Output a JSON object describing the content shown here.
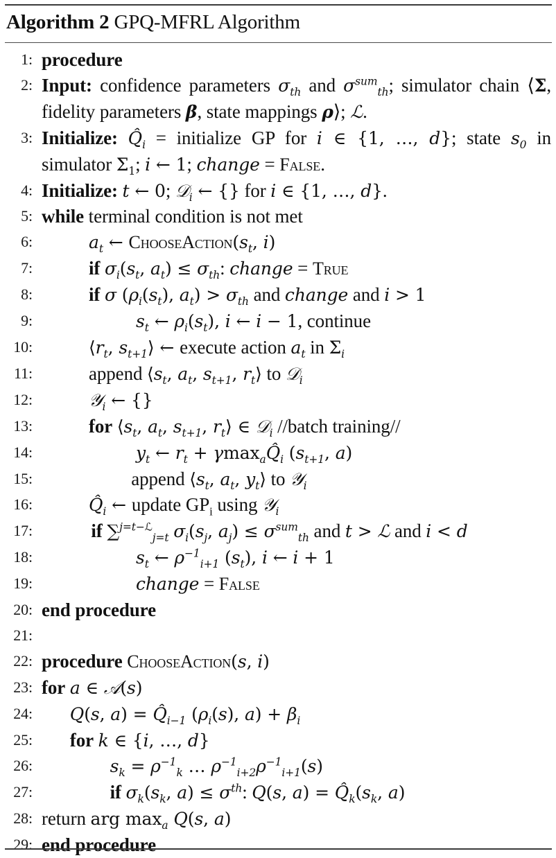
{
  "caption": {
    "label": "Algorithm 2",
    "title": "GPQ-MFRL Algorithm"
  },
  "lines": [
    {
      "n": "1:",
      "indent": 0,
      "segs": [
        [
          "kw",
          "procedure"
        ]
      ]
    },
    {
      "n": "2:",
      "indent": 0,
      "wrap": true,
      "segs": [
        [
          "kw",
          "Input:"
        ],
        [
          "t",
          " confidence parameters "
        ],
        [
          "m",
          "σ<sub>th</sub>"
        ],
        [
          "t",
          " and "
        ],
        [
          "m",
          "σ<sup>sum</sup><sub>th</sub>"
        ],
        [
          "t",
          "; simulator chain ⟨"
        ],
        [
          "mr",
          "<b>Σ</b>"
        ],
        [
          "t",
          ", fidelity parameters "
        ],
        [
          "m",
          "<b>β</b>"
        ],
        [
          "t",
          ", state mappings "
        ],
        [
          "m",
          "<b>ρ</b>"
        ],
        [
          "t",
          "⟩; "
        ],
        [
          "m",
          "ℒ"
        ],
        [
          "t",
          "."
        ]
      ]
    },
    {
      "n": "3:",
      "indent": 0,
      "wrap": true,
      "segs": [
        [
          "kw",
          "Initialize:"
        ],
        [
          "t",
          " "
        ],
        [
          "m",
          "Q̂<sub>i</sub>"
        ],
        [
          "t",
          " = initialize GP for "
        ],
        [
          "m",
          "i"
        ],
        [
          "mr",
          " ∈ {1, …, "
        ],
        [
          "m",
          "d"
        ],
        [
          "mr",
          "}"
        ],
        [
          "t",
          "; state "
        ],
        [
          "m",
          "s<sub>0</sub>"
        ],
        [
          "t",
          " in simulator "
        ],
        [
          "mr",
          "Σ<sub>1</sub>"
        ],
        [
          "t",
          "; "
        ],
        [
          "m",
          "i"
        ],
        [
          "mr",
          " ← 1"
        ],
        [
          "t",
          "; "
        ],
        [
          "m",
          "change"
        ],
        [
          "t",
          " = "
        ],
        [
          "sc",
          "False"
        ],
        [
          "t",
          "."
        ]
      ]
    },
    {
      "n": "4:",
      "indent": 0,
      "segs": [
        [
          "kw",
          "Initialize:"
        ],
        [
          "t",
          " "
        ],
        [
          "m",
          "t"
        ],
        [
          "mr",
          " ← 0"
        ],
        [
          "t",
          "; "
        ],
        [
          "m",
          "𝒟<sub>i</sub>"
        ],
        [
          "mr",
          " ← {}"
        ],
        [
          "t",
          " for "
        ],
        [
          "m",
          "i"
        ],
        [
          "mr",
          " ∈ {1, …, "
        ],
        [
          "m",
          "d"
        ],
        [
          "mr",
          "}"
        ],
        [
          "t",
          "."
        ]
      ]
    },
    {
      "n": "5:",
      "indent": 0,
      "segs": [
        [
          "kw",
          "while"
        ],
        [
          "t",
          " terminal condition is not met"
        ]
      ]
    },
    {
      "n": "6:",
      "indent": 1,
      "segs": [
        [
          "m",
          "a<sub>t</sub>"
        ],
        [
          "mr",
          " ← "
        ],
        [
          "sc",
          "ChooseAction"
        ],
        [
          "mr",
          "("
        ],
        [
          "m",
          "s<sub>t</sub>"
        ],
        [
          "mr",
          ", "
        ],
        [
          "m",
          "i"
        ],
        [
          "mr",
          ")"
        ]
      ]
    },
    {
      "n": "7:",
      "indent": 1,
      "segs": [
        [
          "kw",
          "if"
        ],
        [
          "t",
          " "
        ],
        [
          "m",
          "σ<sub>i</sub>"
        ],
        [
          "mr",
          "("
        ],
        [
          "m",
          "s<sub>t</sub>"
        ],
        [
          "mr",
          ", "
        ],
        [
          "m",
          "a<sub>t</sub>"
        ],
        [
          "mr",
          ") ≤ "
        ],
        [
          "m",
          "σ<sub>th</sub>"
        ],
        [
          "t",
          ": "
        ],
        [
          "m",
          "change"
        ],
        [
          "t",
          " = "
        ],
        [
          "sc",
          "True"
        ]
      ]
    },
    {
      "n": "8:",
      "indent": 1,
      "segs": [
        [
          "kw",
          "if"
        ],
        [
          "t",
          " "
        ],
        [
          "m",
          "σ"
        ],
        [
          "mr",
          " ("
        ],
        [
          "m",
          "ρ<sub>i</sub>"
        ],
        [
          "mr",
          "("
        ],
        [
          "m",
          "s<sub>t</sub>"
        ],
        [
          "mr",
          "), "
        ],
        [
          "m",
          "a<sub>t</sub>"
        ],
        [
          "mr",
          ") > "
        ],
        [
          "m",
          "σ<sub>th</sub>"
        ],
        [
          "t",
          " and "
        ],
        [
          "m",
          "change"
        ],
        [
          "t",
          " and "
        ],
        [
          "m",
          "i"
        ],
        [
          "mr",
          " > 1"
        ]
      ]
    },
    {
      "n": "9:",
      "indent": 2,
      "segs": [
        [
          "m",
          "s<sub>t</sub>"
        ],
        [
          "mr",
          " ← "
        ],
        [
          "m",
          "ρ<sub>i</sub>"
        ],
        [
          "mr",
          "("
        ],
        [
          "m",
          "s<sub>t</sub>"
        ],
        [
          "mr",
          "), "
        ],
        [
          "m",
          "i"
        ],
        [
          "mr",
          " ← "
        ],
        [
          "m",
          "i"
        ],
        [
          "mr",
          " − 1"
        ],
        [
          "t",
          ", continue"
        ]
      ]
    },
    {
      "n": "10:",
      "indent": 1,
      "segs": [
        [
          "mr",
          "⟨"
        ],
        [
          "m",
          "r<sub>t</sub>"
        ],
        [
          "mr",
          ", "
        ],
        [
          "m",
          "s<sub>t+1</sub>"
        ],
        [
          "mr",
          "⟩ ← "
        ],
        [
          "t",
          " execute action "
        ],
        [
          "m",
          "a<sub>t</sub>"
        ],
        [
          "t",
          " in "
        ],
        [
          "mr",
          "Σ<sub><i>i</i></sub>"
        ]
      ]
    },
    {
      "n": "11:",
      "indent": 1,
      "segs": [
        [
          "t",
          "append "
        ],
        [
          "mr",
          "⟨"
        ],
        [
          "m",
          "s<sub>t</sub>"
        ],
        [
          "mr",
          ", "
        ],
        [
          "m",
          "a<sub>t</sub>"
        ],
        [
          "mr",
          ", "
        ],
        [
          "m",
          "s<sub>t+1</sub>"
        ],
        [
          "mr",
          ", "
        ],
        [
          "m",
          "r<sub>t</sub>"
        ],
        [
          "mr",
          "⟩"
        ],
        [
          "t",
          "  to "
        ],
        [
          "m",
          "𝒟<sub>i</sub>"
        ]
      ]
    },
    {
      "n": "12:",
      "indent": 1,
      "segs": [
        [
          "m",
          "𝒴<sub>i</sub>"
        ],
        [
          "mr",
          " ← {}"
        ]
      ]
    },
    {
      "n": "13:",
      "indent": 1,
      "segs": [
        [
          "kw",
          "for"
        ],
        [
          "t",
          " "
        ],
        [
          "mr",
          "⟨"
        ],
        [
          "m",
          "s<sub>t</sub>"
        ],
        [
          "mr",
          ", "
        ],
        [
          "m",
          "a<sub>t</sub>"
        ],
        [
          "mr",
          ", "
        ],
        [
          "m",
          "s<sub>t+1</sub>"
        ],
        [
          "mr",
          ", "
        ],
        [
          "m",
          "r<sub>t</sub>"
        ],
        [
          "mr",
          "⟩ ∈ "
        ],
        [
          "m",
          "𝒟<sub>i</sub>"
        ],
        [
          "t",
          " //batch training//"
        ]
      ]
    },
    {
      "n": "14:",
      "indent": 2,
      "segs": [
        [
          "m",
          "y<sub>t</sub>"
        ],
        [
          "mr",
          " ← "
        ],
        [
          "m",
          "r<sub>t</sub>"
        ],
        [
          "mr",
          " + "
        ],
        [
          "m",
          "γ"
        ],
        [
          "mr",
          "max<sub><i>a</i></sub>"
        ],
        [
          "m",
          "Q̂<sub>i</sub>"
        ],
        [
          "mr",
          " ("
        ],
        [
          "m",
          "s<sub>t+1</sub>"
        ],
        [
          "mr",
          ", "
        ],
        [
          "m",
          "a"
        ],
        [
          "mr",
          ")"
        ]
      ]
    },
    {
      "n": "15:",
      "indent": 1.9,
      "segs": [
        [
          "t",
          "append "
        ],
        [
          "mr",
          "⟨"
        ],
        [
          "m",
          "s<sub>t</sub>"
        ],
        [
          "mr",
          ", "
        ],
        [
          "m",
          "a<sub>t</sub>"
        ],
        [
          "mr",
          ", "
        ],
        [
          "m",
          "y<sub>t</sub>"
        ],
        [
          "mr",
          "⟩"
        ],
        [
          "t",
          " to "
        ],
        [
          "m",
          "𝒴<sub>i</sub>"
        ]
      ]
    },
    {
      "n": "16:",
      "indent": 1,
      "segs": [
        [
          "m",
          "Q̂<sub>i</sub>"
        ],
        [
          "mr",
          " ← "
        ],
        [
          "t",
          " update GP"
        ],
        [
          "t",
          "<sub>i</sub>"
        ],
        [
          "t",
          " using "
        ],
        [
          "m",
          "𝒴<sub>i</sub>"
        ]
      ]
    },
    {
      "n": "17:",
      "indent": 1.05,
      "segs": [
        [
          "kw",
          "if"
        ],
        [
          "t",
          " "
        ],
        [
          "mr",
          "∑<sup><i>j</i>=<i>t</i>−ℒ</sup><sub><i>j</i>=<i>t</i></sub>"
        ],
        [
          "t",
          " "
        ],
        [
          "m",
          "σ<sub>i</sub>"
        ],
        [
          "mr",
          "("
        ],
        [
          "m",
          "s<sub>j</sub>"
        ],
        [
          "mr",
          ", "
        ],
        [
          "m",
          "a<sub>j</sub>"
        ],
        [
          "mr",
          ") ≤ "
        ],
        [
          "m",
          "σ<sup>sum</sup><sub>th</sub>"
        ],
        [
          "t",
          " and "
        ],
        [
          "m",
          "t"
        ],
        [
          "mr",
          " > "
        ],
        [
          "m",
          "ℒ"
        ],
        [
          "t",
          " and "
        ],
        [
          "m",
          "i"
        ],
        [
          "mr",
          " < "
        ],
        [
          "m",
          "d"
        ]
      ]
    },
    {
      "n": "18:",
      "indent": 2,
      "segs": [
        [
          "m",
          "s<sub>t</sub>"
        ],
        [
          "mr",
          " ← "
        ],
        [
          "m",
          "ρ<sup>−1</sup><sub>i+1</sub>"
        ],
        [
          "mr",
          " ("
        ],
        [
          "m",
          "s<sub>t</sub>"
        ],
        [
          "mr",
          "), "
        ],
        [
          "m",
          "i"
        ],
        [
          "mr",
          " ← "
        ],
        [
          "m",
          "i"
        ],
        [
          "mr",
          " + 1"
        ]
      ]
    },
    {
      "n": "19:",
      "indent": 2,
      "segs": [
        [
          "m",
          "change"
        ],
        [
          "t",
          " = "
        ],
        [
          "sc",
          "False"
        ]
      ]
    },
    {
      "n": "20:",
      "indent": 0,
      "segs": [
        [
          "kw",
          "end procedure"
        ]
      ]
    },
    {
      "n": "21:",
      "indent": 0,
      "segs": []
    },
    {
      "n": "22:",
      "indent": 0,
      "segs": [
        [
          "kw",
          "procedure"
        ],
        [
          "t",
          " "
        ],
        [
          "sc",
          "ChooseAction"
        ],
        [
          "mr",
          "("
        ],
        [
          "m",
          "s"
        ],
        [
          "mr",
          ", "
        ],
        [
          "m",
          "i"
        ],
        [
          "mr",
          ")"
        ]
      ]
    },
    {
      "n": "23:",
      "indent": 0,
      "segs": [
        [
          "kw",
          "for"
        ],
        [
          "t",
          " "
        ],
        [
          "m",
          "a"
        ],
        [
          "mr",
          " ∈ "
        ],
        [
          "m",
          "𝒜"
        ],
        [
          "mr",
          "("
        ],
        [
          "m",
          "s"
        ],
        [
          "mr",
          ")"
        ]
      ]
    },
    {
      "n": "24:",
      "indent": 0.6,
      "segs": [
        [
          "m",
          "Q"
        ],
        [
          "mr",
          "("
        ],
        [
          "m",
          "s"
        ],
        [
          "mr",
          ", "
        ],
        [
          "m",
          "a"
        ],
        [
          "mr",
          ") = "
        ],
        [
          "m",
          "Q̂<sub>i−1</sub>"
        ],
        [
          "mr",
          " ("
        ],
        [
          "m",
          "ρ<sub>i</sub>"
        ],
        [
          "mr",
          "("
        ],
        [
          "m",
          "s"
        ],
        [
          "mr",
          "), "
        ],
        [
          "m",
          "a"
        ],
        [
          "mr",
          ") + "
        ],
        [
          "m",
          "β<sub>i</sub>"
        ]
      ]
    },
    {
      "n": "25:",
      "indent": 0.6,
      "segs": [
        [
          "kw",
          "for"
        ],
        [
          "t",
          " "
        ],
        [
          "m",
          "k"
        ],
        [
          "mr",
          " ∈ {"
        ],
        [
          "m",
          "i"
        ],
        [
          "mr",
          ", …, "
        ],
        [
          "m",
          "d"
        ],
        [
          "mr",
          "}"
        ]
      ]
    },
    {
      "n": "26:",
      "indent": 1.45,
      "segs": [
        [
          "m",
          "s<sub>k</sub>"
        ],
        [
          "mr",
          " = "
        ],
        [
          "m",
          "ρ<sup>−1</sup><sub>k</sub>"
        ],
        [
          "mr",
          " … "
        ],
        [
          "m",
          "ρ<sup>−1</sup><sub>i+2</sub>ρ<sup>−1</sup><sub>i+1</sub>"
        ],
        [
          "mr",
          "("
        ],
        [
          "m",
          "s"
        ],
        [
          "mr",
          ")"
        ]
      ]
    },
    {
      "n": "27:",
      "indent": 1.45,
      "segs": [
        [
          "kw",
          "if"
        ],
        [
          "t",
          " "
        ],
        [
          "m",
          "σ<sub>k</sub>"
        ],
        [
          "mr",
          "("
        ],
        [
          "m",
          "s<sub>k</sub>"
        ],
        [
          "mr",
          ", "
        ],
        [
          "m",
          "a"
        ],
        [
          "mr",
          ") ≤ "
        ],
        [
          "m",
          "σ<sup>th</sup>"
        ],
        [
          "t",
          ": "
        ],
        [
          "m",
          "Q"
        ],
        [
          "mr",
          "("
        ],
        [
          "m",
          "s"
        ],
        [
          "mr",
          ", "
        ],
        [
          "m",
          "a"
        ],
        [
          "mr",
          ") = "
        ],
        [
          "m",
          "Q̂<sub>k</sub>"
        ],
        [
          "mr",
          "("
        ],
        [
          "m",
          "s<sub>k</sub>"
        ],
        [
          "mr",
          ", "
        ],
        [
          "m",
          "a"
        ],
        [
          "mr",
          ")"
        ]
      ]
    },
    {
      "n": "28:",
      "indent": 0,
      "segs": [
        [
          "t",
          "return "
        ],
        [
          "mr",
          "arg max<sub><i>a</i></sub> "
        ],
        [
          "m",
          "Q"
        ],
        [
          "mr",
          "("
        ],
        [
          "m",
          "s"
        ],
        [
          "mr",
          ", "
        ],
        [
          "m",
          "a"
        ],
        [
          "mr",
          ")"
        ]
      ]
    },
    {
      "n": "29:",
      "indent": 0,
      "segs": [
        [
          "kw",
          "end procedure"
        ]
      ]
    }
  ]
}
